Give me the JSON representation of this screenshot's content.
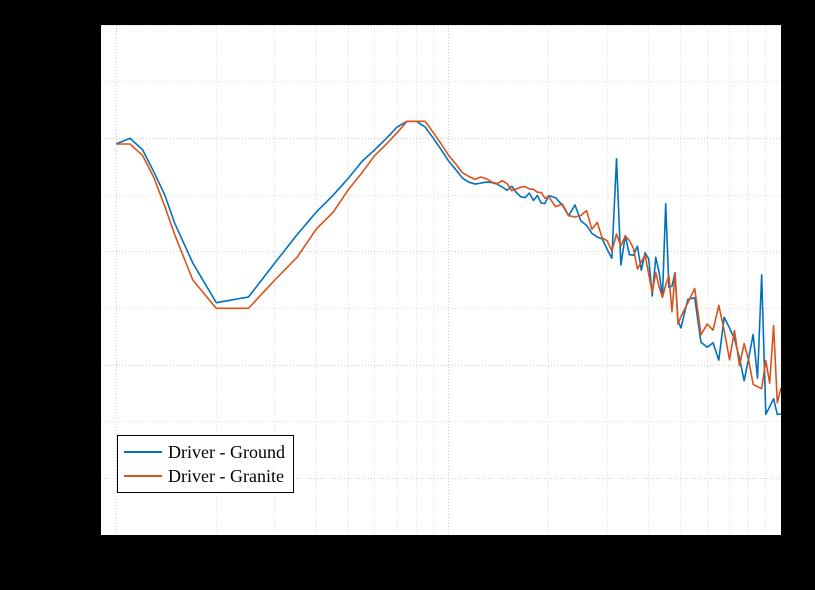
{
  "chart_data": {
    "type": "line",
    "title": "",
    "xlabel": "",
    "ylabel": "",
    "xscale": "log",
    "xlim": [
      0.9,
      100
    ],
    "ylim": [
      -90,
      0
    ],
    "legend_position": "lower-left",
    "grid": true,
    "colors": {
      "ground": "#0072bd",
      "granite": "#d95319"
    },
    "series": [
      {
        "name": "Driver - Ground",
        "color": "#0072bd",
        "x": [
          1.0,
          1.1,
          1.2,
          1.3,
          1.4,
          1.5,
          1.7,
          2.0,
          2.5,
          3.0,
          3.5,
          4.0,
          4.5,
          5.0,
          5.5,
          6.0,
          6.5,
          7.0,
          7.5,
          8.0,
          8.5,
          9.0,
          9.5,
          10,
          11,
          12,
          13,
          14,
          15,
          16,
          17,
          18,
          19,
          20,
          22,
          24,
          26,
          28,
          30,
          32,
          34,
          36,
          38,
          40,
          42,
          44,
          46,
          48,
          50,
          55,
          60,
          65,
          70,
          75,
          80,
          85,
          90,
          95,
          100
        ],
        "y": [
          -21,
          -20,
          -22,
          -26,
          -30,
          -35,
          -42,
          -49,
          -48,
          -42,
          -37,
          -33,
          -30,
          -27,
          -24,
          -22,
          -20,
          -18,
          -17,
          -17,
          -18,
          -20,
          -22,
          -24,
          -27,
          -28,
          -28,
          -28,
          -29,
          -29,
          -30,
          -30,
          -31,
          -31,
          -32,
          -33,
          -35,
          -36,
          -38,
          -39,
          -40,
          -41,
          -43,
          -44,
          -45,
          -46,
          -47,
          -48,
          -49,
          -51,
          -53,
          -55,
          -57,
          -58,
          -59,
          -61,
          -63,
          -64,
          -66
        ]
      },
      {
        "name": "Driver - Granite",
        "color": "#d95319",
        "x": [
          1.0,
          1.1,
          1.2,
          1.3,
          1.4,
          1.5,
          1.7,
          2.0,
          2.5,
          3.0,
          3.5,
          4.0,
          4.5,
          5.0,
          5.5,
          6.0,
          6.5,
          7.0,
          7.5,
          8.0,
          8.5,
          9.0,
          9.5,
          10,
          11,
          12,
          13,
          14,
          15,
          16,
          17,
          18,
          19,
          20,
          22,
          24,
          26,
          28,
          30,
          32,
          34,
          36,
          38,
          40,
          42,
          44,
          46,
          48,
          50,
          55,
          60,
          65,
          70,
          75,
          80,
          85,
          90,
          95,
          100
        ],
        "y": [
          -21,
          -21,
          -23,
          -27,
          -32,
          -37,
          -45,
          -50,
          -50,
          -45,
          -41,
          -36,
          -33,
          -29,
          -26,
          -23,
          -21,
          -19,
          -17,
          -17,
          -17,
          -19,
          -21,
          -23,
          -26,
          -27,
          -27,
          -28,
          -28,
          -29,
          -29,
          -30,
          -30,
          -31,
          -32,
          -33,
          -34,
          -36,
          -37,
          -38,
          -40,
          -41,
          -42,
          -44,
          -45,
          -46,
          -47,
          -48,
          -49,
          -51,
          -52,
          -54,
          -56,
          -57,
          -59,
          -60,
          -62,
          -63,
          -65
        ]
      }
    ]
  },
  "legend": {
    "items": [
      {
        "label": "Driver - Ground",
        "color": "#0072bd"
      },
      {
        "label": "Driver - Granite",
        "color": "#d95319"
      }
    ]
  }
}
